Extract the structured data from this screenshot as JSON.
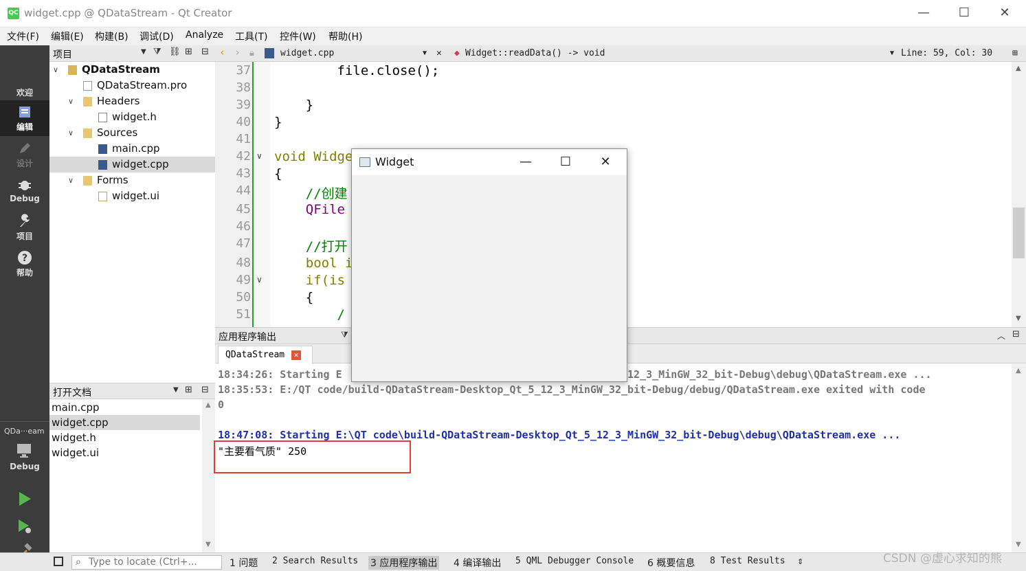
{
  "window": {
    "title": "widget.cpp @ QDataStream - Qt Creator",
    "logo_text": "QC",
    "controls": [
      "—",
      "☐",
      "✕"
    ]
  },
  "menu": [
    "文件(F)",
    "编辑(E)",
    "构建(B)",
    "调试(D)",
    "Analyze",
    "工具(T)",
    "控件(W)",
    "帮助(H)"
  ],
  "modes": [
    {
      "label": "欢迎",
      "icon": "grid-icon"
    },
    {
      "label": "编辑",
      "icon": "edit-icon"
    },
    {
      "label": "设计",
      "icon": "pencil-icon"
    },
    {
      "label": "Debug",
      "icon": "bug-icon"
    },
    {
      "label": "项目",
      "icon": "wrench-icon"
    },
    {
      "label": "帮助",
      "icon": "help-icon"
    }
  ],
  "kit": {
    "name": "QDa···eam",
    "mode": "Debug"
  },
  "projects": {
    "title": "项目",
    "tree": [
      {
        "label": "QDataStream",
        "depth": 0,
        "arrow": "∨",
        "bold": true
      },
      {
        "label": "QDataStream.pro",
        "depth": 1,
        "arrow": ""
      },
      {
        "label": "Headers",
        "depth": 1,
        "arrow": "∨"
      },
      {
        "label": "widget.h",
        "depth": 2,
        "arrow": ""
      },
      {
        "label": "Sources",
        "depth": 1,
        "arrow": "∨"
      },
      {
        "label": "main.cpp",
        "depth": 2,
        "arrow": ""
      },
      {
        "label": "widget.cpp",
        "depth": 2,
        "arrow": "",
        "selected": true
      },
      {
        "label": "Forms",
        "depth": 1,
        "arrow": "∨"
      },
      {
        "label": "widget.ui",
        "depth": 2,
        "arrow": ""
      }
    ]
  },
  "open_documents": {
    "title": "打开文档",
    "items": [
      {
        "label": "main.cpp"
      },
      {
        "label": "widget.cpp",
        "selected": true
      },
      {
        "label": "widget.h"
      },
      {
        "label": "widget.ui"
      }
    ]
  },
  "editor": {
    "file": "widget.cpp",
    "symbol": "Widget::readData() -> void",
    "position": "Line: 59, Col: 30",
    "lines": [
      {
        "n": "37",
        "code": "        file.close();"
      },
      {
        "n": "38",
        "code": ""
      },
      {
        "n": "39",
        "code": "    }"
      },
      {
        "n": "40",
        "code": "}"
      },
      {
        "n": "41",
        "code": ""
      },
      {
        "n": "42",
        "code": "void Widge",
        "fold": "∨"
      },
      {
        "n": "43",
        "code": "{"
      },
      {
        "n": "44",
        "code": "    //创建"
      },
      {
        "n": "45",
        "code": "    QFile"
      },
      {
        "n": "46",
        "code": ""
      },
      {
        "n": "47",
        "code": "    //打开"
      },
      {
        "n": "48",
        "code": "    bool i                              ly);"
      },
      {
        "n": "49",
        "code": "    if(is",
        "fold": "∨"
      },
      {
        "n": "50",
        "code": "    {"
      },
      {
        "n": "51",
        "code": "        /"
      }
    ]
  },
  "output": {
    "title": "应用程序输出",
    "tab": "QDataStream",
    "lines": [
      {
        "text": "18:34:26: Starting E                                            5_12_3_MinGW_32_bit-Debug\\debug\\QDataStream.exe ...",
        "style": "grey"
      },
      {
        "text": "18:35:53: E:/QT code/build-QDataStream-Desktop_Qt_5_12_3_MinGW_32_bit-Debug/debug/QDataStream.exe exited with code",
        "style": "grey"
      },
      {
        "text": "0",
        "style": "grey"
      },
      {
        "text": "",
        "style": "grey"
      },
      {
        "text": "18:47:08: Starting E:\\QT code\\build-QDataStream-Desktop_Qt_5_12_3_MinGW_32_bit-Debug\\debug\\QDataStream.exe ...",
        "style": "blue"
      },
      {
        "text": "\"主要看气质\" 250",
        "style": "plain"
      }
    ]
  },
  "statusbar": {
    "locator_placeholder": "Type to locate (Ctrl+...",
    "panes": [
      "1 问题",
      "2 Search Results",
      "3 应用程序输出",
      "4 编译输出",
      "5 QML Debugger Console",
      "6 概要信息",
      "8 Test Results"
    ],
    "active_pane": 2
  },
  "watermark": "CSDN @虚心求知的熊",
  "widget_window": {
    "title": "Widget",
    "controls": [
      "—",
      "☐",
      "✕"
    ]
  }
}
